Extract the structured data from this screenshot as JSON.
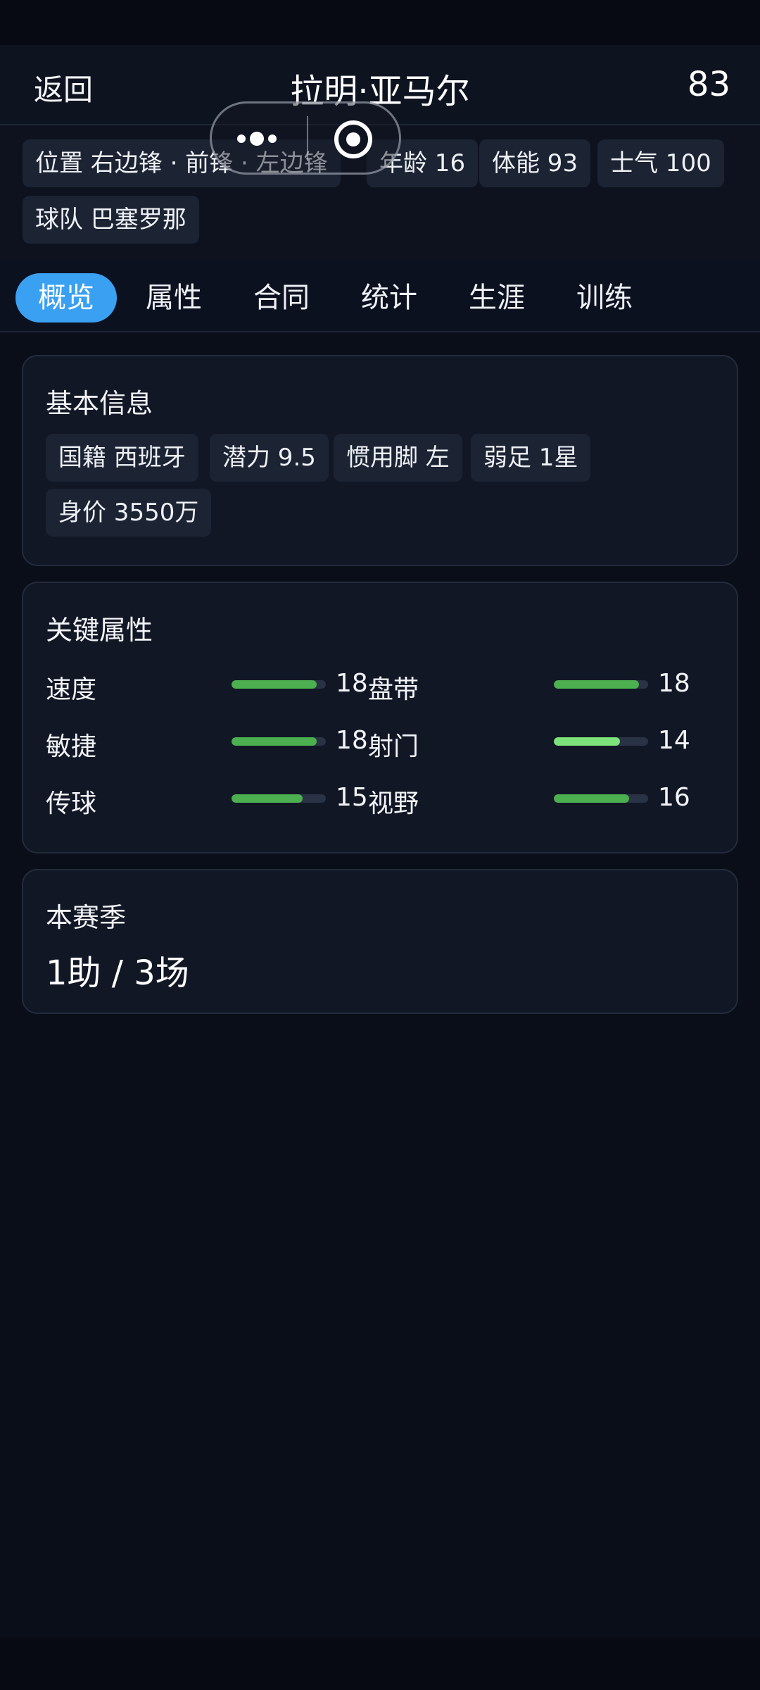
{
  "header": {
    "back_label": "返回",
    "title": "拉明·亚马尔",
    "rating": "83"
  },
  "info_chips": {
    "position": "位置 右边锋 · 前锋 · 左边锋",
    "age": "年龄 16",
    "stamina": "体能 93",
    "morale": "士气 100",
    "team": "球队 巴塞罗那"
  },
  "tabs": [
    "概览",
    "属性",
    "合同",
    "统计",
    "生涯",
    "训练"
  ],
  "active_tab": "概览",
  "basic_info": {
    "title": "基本信息",
    "chips": [
      "国籍 西班牙",
      "潜力 9.5",
      "惯用脚 左",
      "弱足 1星",
      "身价 3550万"
    ]
  },
  "key_attributes": {
    "title": "关键属性",
    "scale_max": 20,
    "left": [
      {
        "name": "速度",
        "value": 18
      },
      {
        "name": "敏捷",
        "value": 18
      },
      {
        "name": "传球",
        "value": 15
      }
    ],
    "right": [
      {
        "name": "盘带",
        "value": 18
      },
      {
        "name": "射门",
        "value": 14
      },
      {
        "name": "视野",
        "value": 16
      }
    ]
  },
  "season": {
    "title": "本赛季",
    "summary": "1助 / 3场"
  },
  "colors": {
    "accent": "#3aa0f2",
    "bar": "#4caf50",
    "bar_light": "#7ee27a",
    "background": "#0a0e18"
  },
  "icons": {
    "capsule_more": "more-dots-icon",
    "capsule_close": "target-circle-icon"
  }
}
